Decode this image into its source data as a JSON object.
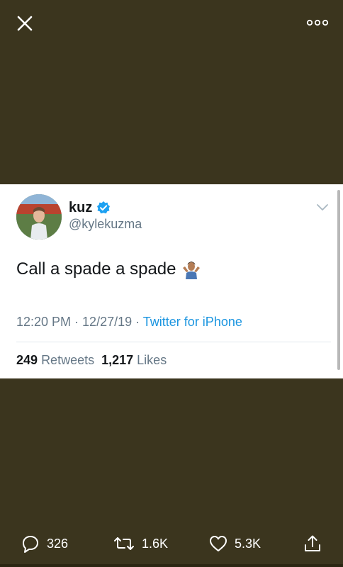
{
  "header": {
    "close_icon": "close-icon",
    "more_icon": "more-options-icon"
  },
  "tweet": {
    "display_name": "kuz",
    "verified": true,
    "handle": "@kylekuzma",
    "text": "Call a spade a spade",
    "emoji": "person-shrugging",
    "time": "12:20 PM",
    "date": "12/27/19",
    "separator": " · ",
    "source": "Twitter for iPhone",
    "retweets_count": "249",
    "retweets_label": "Retweets",
    "likes_count": "1,217",
    "likes_label": "Likes"
  },
  "actions": {
    "replies": "326",
    "retweets": "1.6K",
    "likes": "5.3K"
  },
  "colors": {
    "backdrop": "#3b351e",
    "link": "#1b95e0",
    "verified": "#1da1f2",
    "secondary_text": "#657786"
  }
}
